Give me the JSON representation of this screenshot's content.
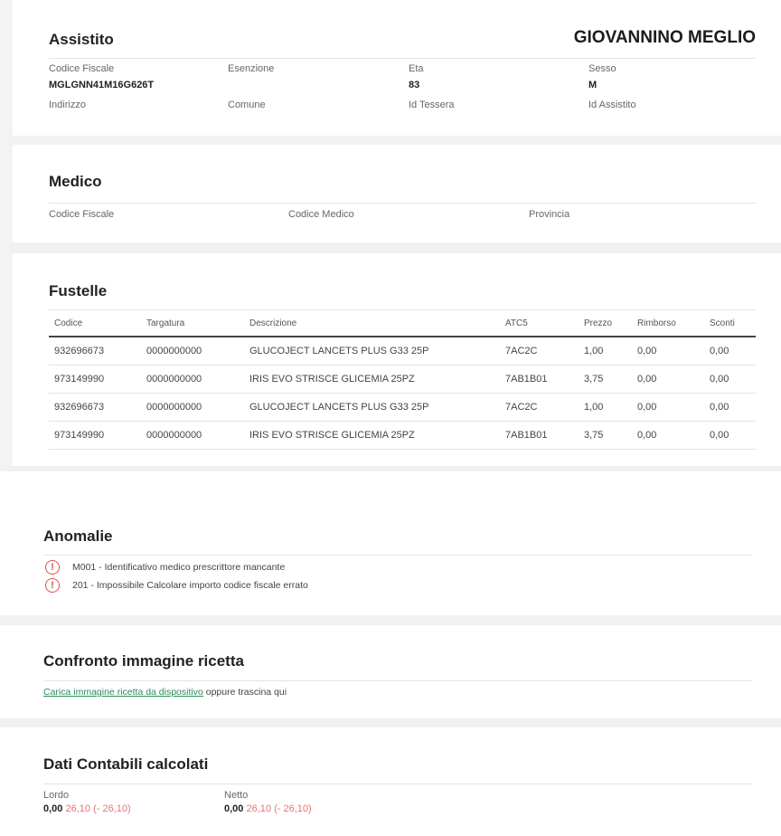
{
  "assistito": {
    "title": "Assistito",
    "name": "GIOVANNINO MEGLIO",
    "codice_fiscale_label": "Codice Fiscale",
    "codice_fiscale_value": "MGLGNN41M16G626T",
    "esenzione_label": "Esenzione",
    "eta_label": "Eta",
    "eta_value": "83",
    "sesso_label": "Sesso",
    "sesso_value": "M",
    "indirizzo_label": "Indirizzo",
    "comune_label": "Comune",
    "id_tessera_label": "Id Tessera",
    "id_assistito_label": "Id Assistito"
  },
  "medico": {
    "title": "Medico",
    "codice_fiscale_label": "Codice Fiscale",
    "codice_medico_label": "Codice Medico",
    "provincia_label": "Provincia"
  },
  "fustelle": {
    "title": "Fustelle",
    "columns": [
      "Codice",
      "Targatura",
      "Descrizione",
      "ATC5",
      "Prezzo",
      "Rimborso",
      "Sconti"
    ],
    "rows": [
      [
        "932696673",
        "0000000000",
        "GLUCOJECT LANCETS PLUS G33 25P",
        "7AC2C",
        "1,00",
        "0,00",
        "0,00"
      ],
      [
        "973149990",
        "0000000000",
        "IRIS EVO STRISCE GLICEMIA 25PZ",
        "7AB1B01",
        "3,75",
        "0,00",
        "0,00"
      ],
      [
        "932696673",
        "0000000000",
        "GLUCOJECT LANCETS PLUS G33 25P",
        "7AC2C",
        "1,00",
        "0,00",
        "0,00"
      ],
      [
        "973149990",
        "0000000000",
        "IRIS EVO STRISCE GLICEMIA 25PZ",
        "7AB1B01",
        "3,75",
        "0,00",
        "0,00"
      ]
    ]
  },
  "anomalie": {
    "title": "Anomalie",
    "items": [
      "M001 - Identificativo medico prescrittore mancante",
      "201 - Impossibile Calcolare importo codice fiscale errato"
    ]
  },
  "confronto": {
    "title": "Confronto immagine ricetta",
    "upload_link": "Carica immagine ricetta da dispositivo",
    "upload_suffix": " oppure trascina qui"
  },
  "contabili": {
    "title": "Dati Contabili calcolati",
    "lordo_label": "Lordo",
    "lordo_value": "0,00",
    "lordo_diff": "26,10 (- 26,10)",
    "netto_label": "Netto",
    "netto_value": "0,00",
    "netto_diff": "26,10 (- 26,10)"
  },
  "colors": {
    "accent": "#2e8b57",
    "warning": "#d9534f",
    "diff": "#e57373",
    "band": "#f1f1f1"
  }
}
